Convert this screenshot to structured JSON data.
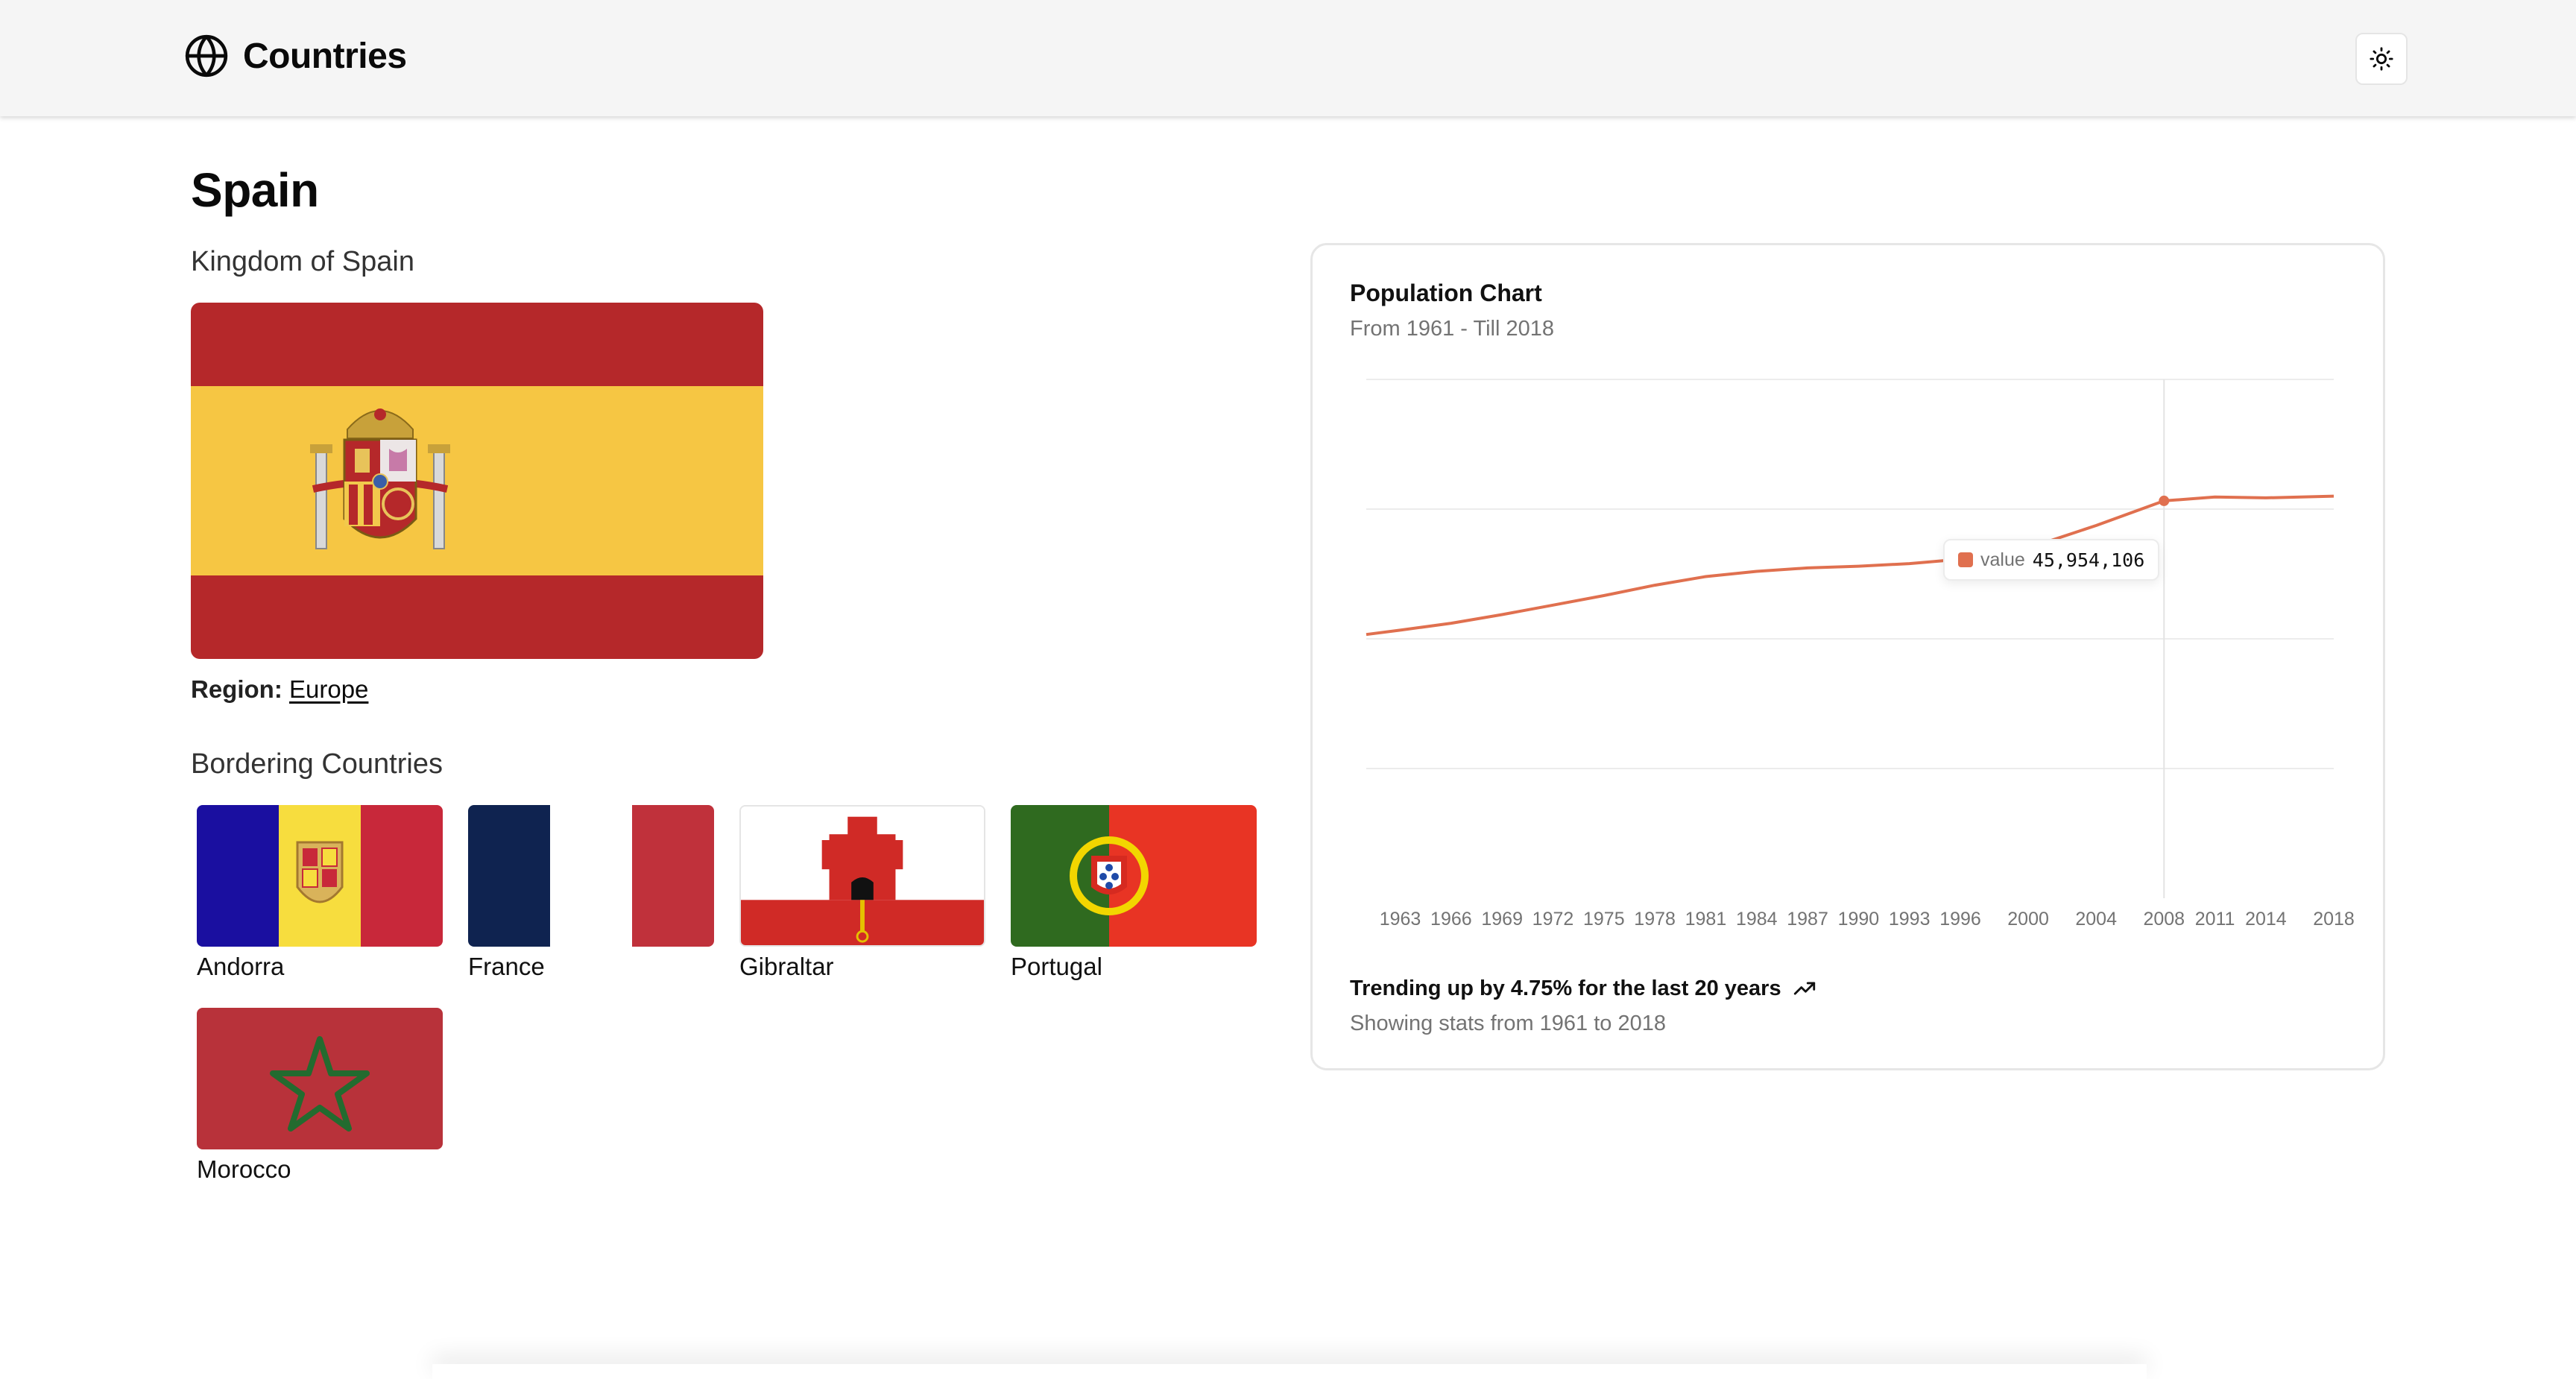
{
  "header": {
    "app_title": "Countries",
    "globe_icon": "globe-icon",
    "theme_toggle_icon": "sun-icon"
  },
  "country": {
    "name": "Spain",
    "official_name": "Kingdom of Spain",
    "region_label": "Region:",
    "region_value": "Europe"
  },
  "bordering": {
    "title": "Bordering Countries",
    "countries": [
      "Andorra",
      "France",
      "Gibraltar",
      "Portugal",
      "Morocco"
    ]
  },
  "chart": {
    "title": "Population Chart",
    "subtitle": "From 1961 - Till 2018",
    "tooltip_key": "value",
    "tooltip_value": "45,954,106",
    "footer_trend": "Trending up by 4.75% for the last 20 years",
    "footer_note": "Showing stats from 1961 to 2018",
    "accent": "#e0704f"
  },
  "chart_data": {
    "type": "line",
    "x": [
      1961,
      1963,
      1966,
      1969,
      1972,
      1975,
      1978,
      1981,
      1984,
      1987,
      1990,
      1993,
      1996,
      2000,
      2004,
      2008,
      2011,
      2014,
      2018
    ],
    "values": [
      30500000,
      31000000,
      31800000,
      32800000,
      33900000,
      35000000,
      36200000,
      37200000,
      37800000,
      38200000,
      38400000,
      38700000,
      39200000,
      40500000,
      43100000,
      45954106,
      46400000,
      46300000,
      46500000
    ],
    "tick_labels": [
      "1963",
      "1966",
      "1969",
      "1972",
      "1975",
      "1978",
      "1981",
      "1984",
      "1987",
      "1990",
      "1993",
      "1996",
      "2000",
      "2004",
      "2008",
      "2011",
      "2014",
      "2018"
    ],
    "highlight": {
      "x": 2008,
      "value": 45954106
    },
    "ylim": [
      0,
      60000000
    ],
    "grid": true
  }
}
